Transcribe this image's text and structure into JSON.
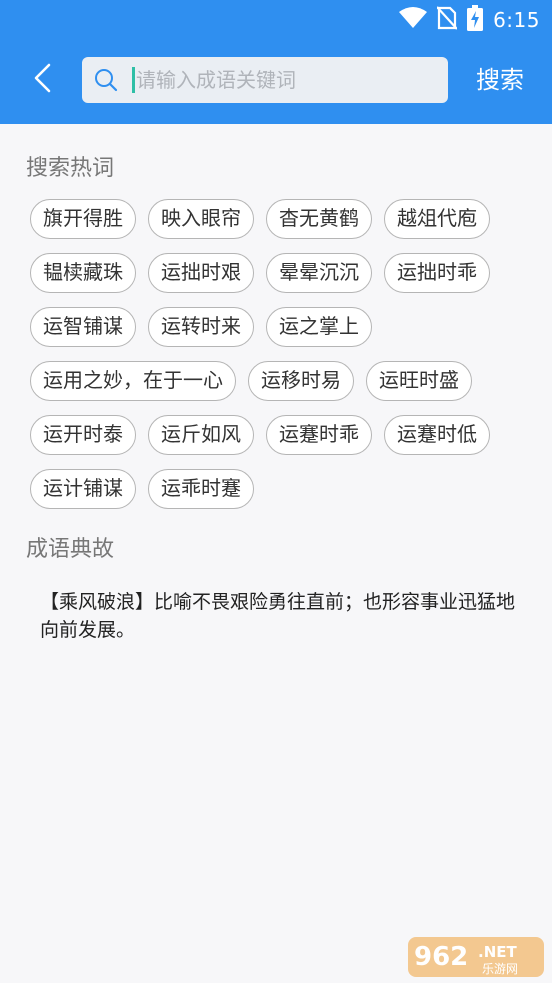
{
  "status_bar": {
    "time": "6:15",
    "icons": [
      "wifi-icon",
      "no-sim-icon",
      "battery-charging-icon"
    ]
  },
  "header": {
    "back_icon": "chevron-left-icon",
    "search_icon": "search-icon",
    "search_placeholder": "请输入成语关键词",
    "search_value": "",
    "search_button": "搜索",
    "colors": {
      "bar": "#2f8ff0",
      "caret": "#2ebfa6"
    }
  },
  "hot_words": {
    "title": "搜索热词",
    "items": [
      "旗开得胜",
      "映入眼帘",
      "杳无黄鹤",
      "越俎代庖",
      "韫椟藏珠",
      "运拙时艰",
      "晕晕沉沉",
      "运拙时乖",
      "运智铺谋",
      "运转时来",
      "运之掌上",
      "运用之妙，在于一心",
      "运移时易",
      "运旺时盛",
      "运开时泰",
      "运斤如风",
      "运蹇时乖",
      "运蹇时低",
      "运计铺谋",
      "运乖时蹇"
    ]
  },
  "allusion": {
    "title": "成语典故",
    "text": "【乘风破浪】比喻不畏艰险勇往直前；也形容事业迅猛地向前发展。"
  },
  "watermark": {
    "number": "962",
    "suffix": ".NET",
    "sub": "乐游网"
  }
}
